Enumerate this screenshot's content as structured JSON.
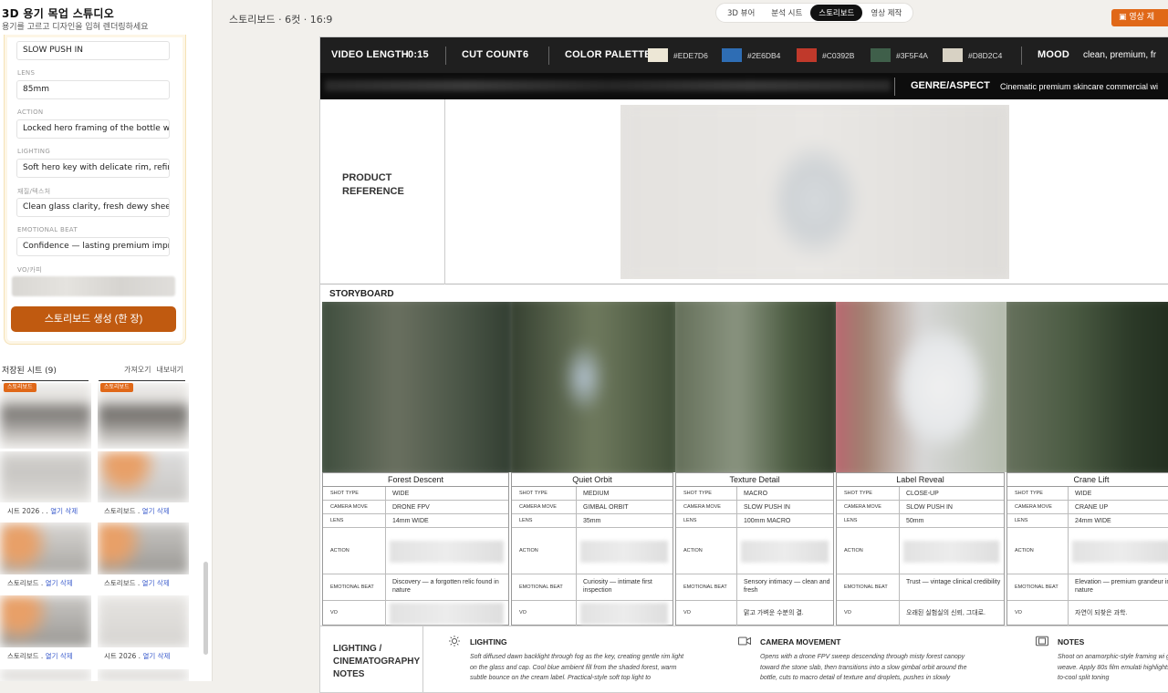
{
  "app": {
    "title": "3D 용기 목업 스튜디오",
    "subtitle": "용기를 고르고 디자인을 입혀 렌더링하세요"
  },
  "form": {
    "first_value": "SLOW PUSH IN",
    "fields": [
      {
        "label": "LENS",
        "value": "85mm"
      },
      {
        "label": "ACTION",
        "value": "Locked hero framing of the bottle wi"
      },
      {
        "label": "LIGHTING",
        "value": "Soft hero key with delicate rim, refine"
      },
      {
        "label": "재질/텍스처",
        "value": "Clean glass clarity, fresh dewy sheen"
      },
      {
        "label": "EMOTIONAL BEAT",
        "value": "Confidence — lasting premium impre"
      }
    ],
    "vo_label": "VO/카피",
    "generate_button": "스토리보드 생성 (한 장)"
  },
  "saved": {
    "title": "저장된 시트 (9)",
    "import": "가져오기",
    "export": "내보내기",
    "badge": "스토리보드",
    "rows": [
      {
        "left": "시트 2026 . .",
        "right": "스토리보드 .",
        "open": "열기",
        "delete": "삭제"
      },
      {
        "left": "스토리보드 .",
        "right": "스토리보드 .",
        "open": "열기",
        "delete": "삭제"
      },
      {
        "left": "스토리보드 .",
        "right": "시트 2026 .",
        "open": "열기",
        "delete": "삭제"
      }
    ]
  },
  "topbar": {
    "title": "스토리보드 · 6컷 · 16:9",
    "tabs": [
      "3D 뷰어",
      "분석 시트",
      "스토리보드",
      "영상 제작"
    ],
    "active_tab": "스토리보드",
    "video_button": "영상 제"
  },
  "sheet": {
    "video_length_label": "VIDEO LENGTH",
    "video_length": "0:15",
    "cut_count_label": "CUT COUNT",
    "cut_count": "6",
    "color_palette_label": "COLOR PALETTE",
    "palette": [
      {
        "hex": "#EDE7D6",
        "label": "#EDE7D6"
      },
      {
        "hex": "#2E6DB4",
        "label": "#2E6DB4"
      },
      {
        "hex": "#C0392B",
        "label": "#C0392B"
      },
      {
        "hex": "#3F5F4A",
        "label": "#3F5F4A"
      },
      {
        "hex": "#D8D2C4",
        "label": "#D8D2C4"
      }
    ],
    "mood_label": "MOOD",
    "mood": "clean, premium, fr",
    "genre_label": "GENRE/ASPECT",
    "genre": "Cinematic premium skincare commercial wi",
    "product_reference_label": "PRODUCT REFERENCE",
    "storyboard_label": "STORYBOARD",
    "row_labels": {
      "shot_type": "SHOT TYPE",
      "camera_move": "CAMERA MOVE",
      "lens": "LENS",
      "action": "ACTION",
      "emotional_beat": "EMOTIONAL BEAT",
      "vo": "VO"
    },
    "shots": [
      {
        "title": "Forest Descent",
        "shot_type": "WIDE",
        "camera_move": "DRONE FPV",
        "lens": "14mm WIDE",
        "emotional_beat": "Discovery — a forgotten relic found in nature",
        "vo": ""
      },
      {
        "title": "Quiet Orbit",
        "shot_type": "MEDIUM",
        "camera_move": "GIMBAL ORBIT",
        "lens": "35mm",
        "emotional_beat": "Curiosity — intimate first inspection",
        "vo": ""
      },
      {
        "title": "Texture Detail",
        "shot_type": "MACRO",
        "camera_move": "SLOW PUSH IN",
        "lens": "100mm MACRO",
        "emotional_beat": "Sensory intimacy — clean and fresh",
        "vo": "맑고 가벼운 수분의 결."
      },
      {
        "title": "Label Reveal",
        "shot_type": "CLOSE-UP",
        "camera_move": "SLOW PUSH IN",
        "lens": "50mm",
        "emotional_beat": "Trust — vintage clinical credibility",
        "vo": "오래된 실험실의 신뢰, 그대로."
      },
      {
        "title": "Crane Lift",
        "shot_type": "WIDE",
        "camera_move": "CRANE UP",
        "lens": "24mm WIDE",
        "emotional_beat": "Elevation — premium grandeur in nature",
        "vo": "자연이 되찾은 과학."
      }
    ],
    "notes_label": "LIGHTING / CINEMATOGRAPHY NOTES",
    "notes": [
      {
        "icon": "sun-icon",
        "title": "LIGHTING",
        "text": "Soft diffused dawn backlight through fog as the key, creating gentle rim light on the glass and cap. Cool blue ambient fill from the shaded forest, warm subtle bounce on the cream label. Practical-style soft top light to"
      },
      {
        "icon": "video-camera-icon",
        "title": "CAMERA MOVEMENT",
        "text": "Opens with a drone FPV sweep descending through misty forest canopy toward the stone slab, then transitions into a slow gimbal orbit around the bottle, cuts to macro detail of texture and droplets, pushes in slowly"
      },
      {
        "icon": "film-icon",
        "title": "NOTES",
        "text": "Shoot on anamorphic-style framing wi gate weave. Apply 80s film emulati highlights, warm-to-cool split toning"
      }
    ]
  }
}
